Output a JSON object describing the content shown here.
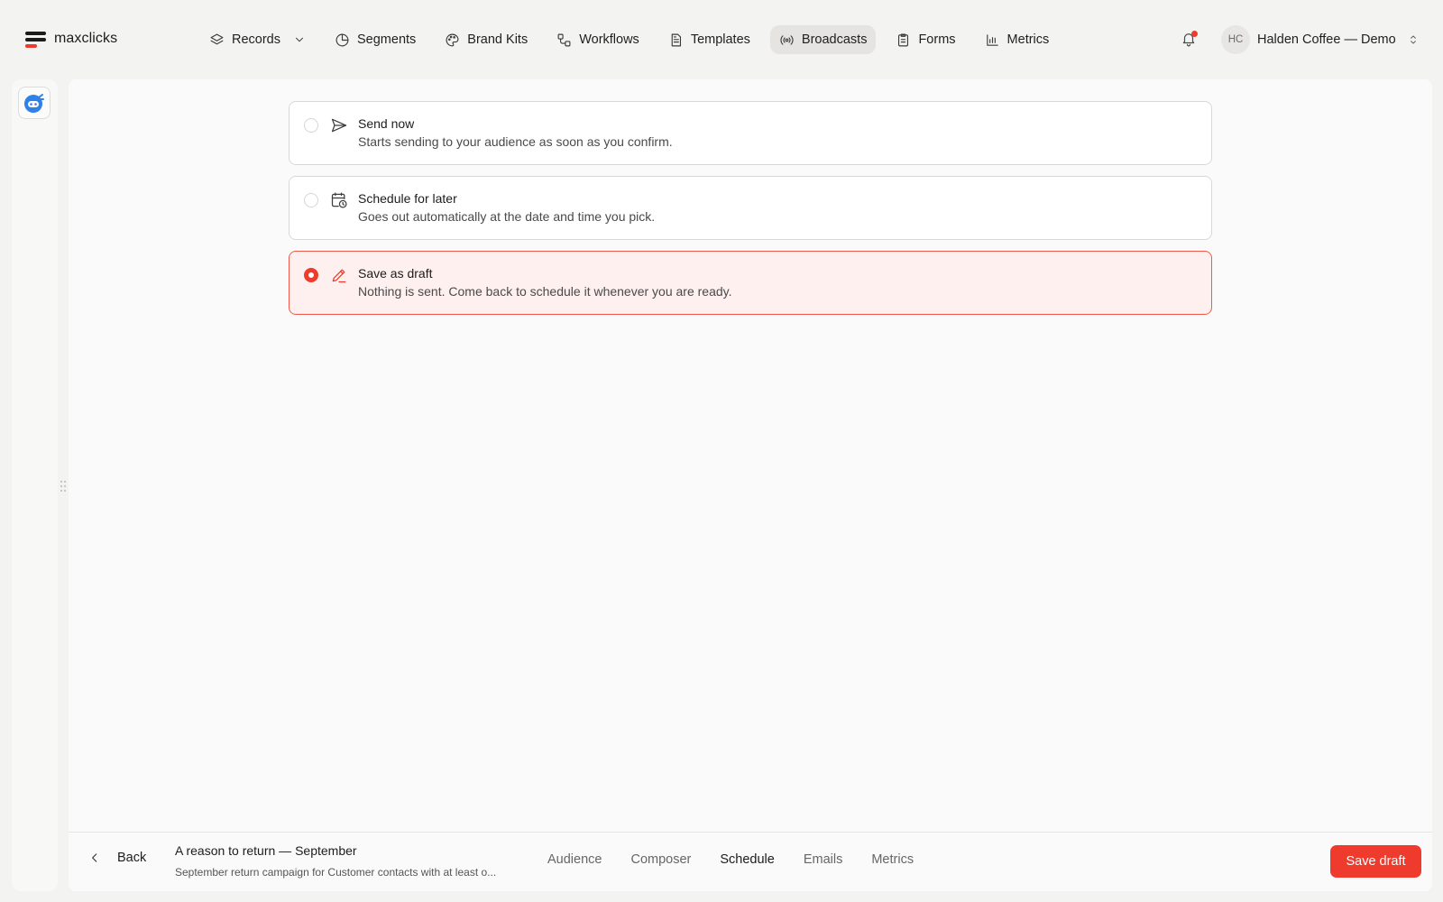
{
  "app": {
    "name": "maxclicks"
  },
  "nav": {
    "items": [
      {
        "label": "Records",
        "icon": "layers-icon",
        "has_dropdown": true
      },
      {
        "label": "Segments",
        "icon": "pie-chart-icon"
      },
      {
        "label": "Brand Kits",
        "icon": "palette-icon"
      },
      {
        "label": "Workflows",
        "icon": "workflow-icon"
      },
      {
        "label": "Templates",
        "icon": "document-icon"
      },
      {
        "label": "Broadcasts",
        "icon": "broadcast-icon",
        "active": true
      },
      {
        "label": "Forms",
        "icon": "clipboard-icon"
      },
      {
        "label": "Metrics",
        "icon": "bar-chart-icon"
      }
    ]
  },
  "notifications": {
    "icon": "bell-icon",
    "has_unread": true
  },
  "account": {
    "initials": "HC",
    "name": "Halden Coffee — Demo"
  },
  "delivery": {
    "options": [
      {
        "title": "Send now",
        "description": "Starts sending to your audience as soon as you confirm.",
        "icon": "send-icon",
        "selected": false
      },
      {
        "title": "Schedule for later",
        "description": "Goes out automatically at the date and time you pick.",
        "icon": "calendar-clock-icon",
        "selected": false
      },
      {
        "title": "Save as draft",
        "description": "Nothing is sent. Come back to schedule it whenever you are ready.",
        "icon": "pencil-icon",
        "selected": true
      }
    ]
  },
  "footer": {
    "back_label": "Back",
    "campaign_title": "A reason to return — September",
    "campaign_description": "September return campaign for Customer contacts with at least o...",
    "tabs": [
      "Audience",
      "Composer",
      "Schedule",
      "Emails",
      "Metrics"
    ],
    "active_tab": "Schedule",
    "save_label": "Save draft"
  },
  "colors": {
    "accent": "#ef3b2d",
    "selected_bg": "#fdf0ee",
    "active_nav_bg": "#e6e4e1"
  }
}
